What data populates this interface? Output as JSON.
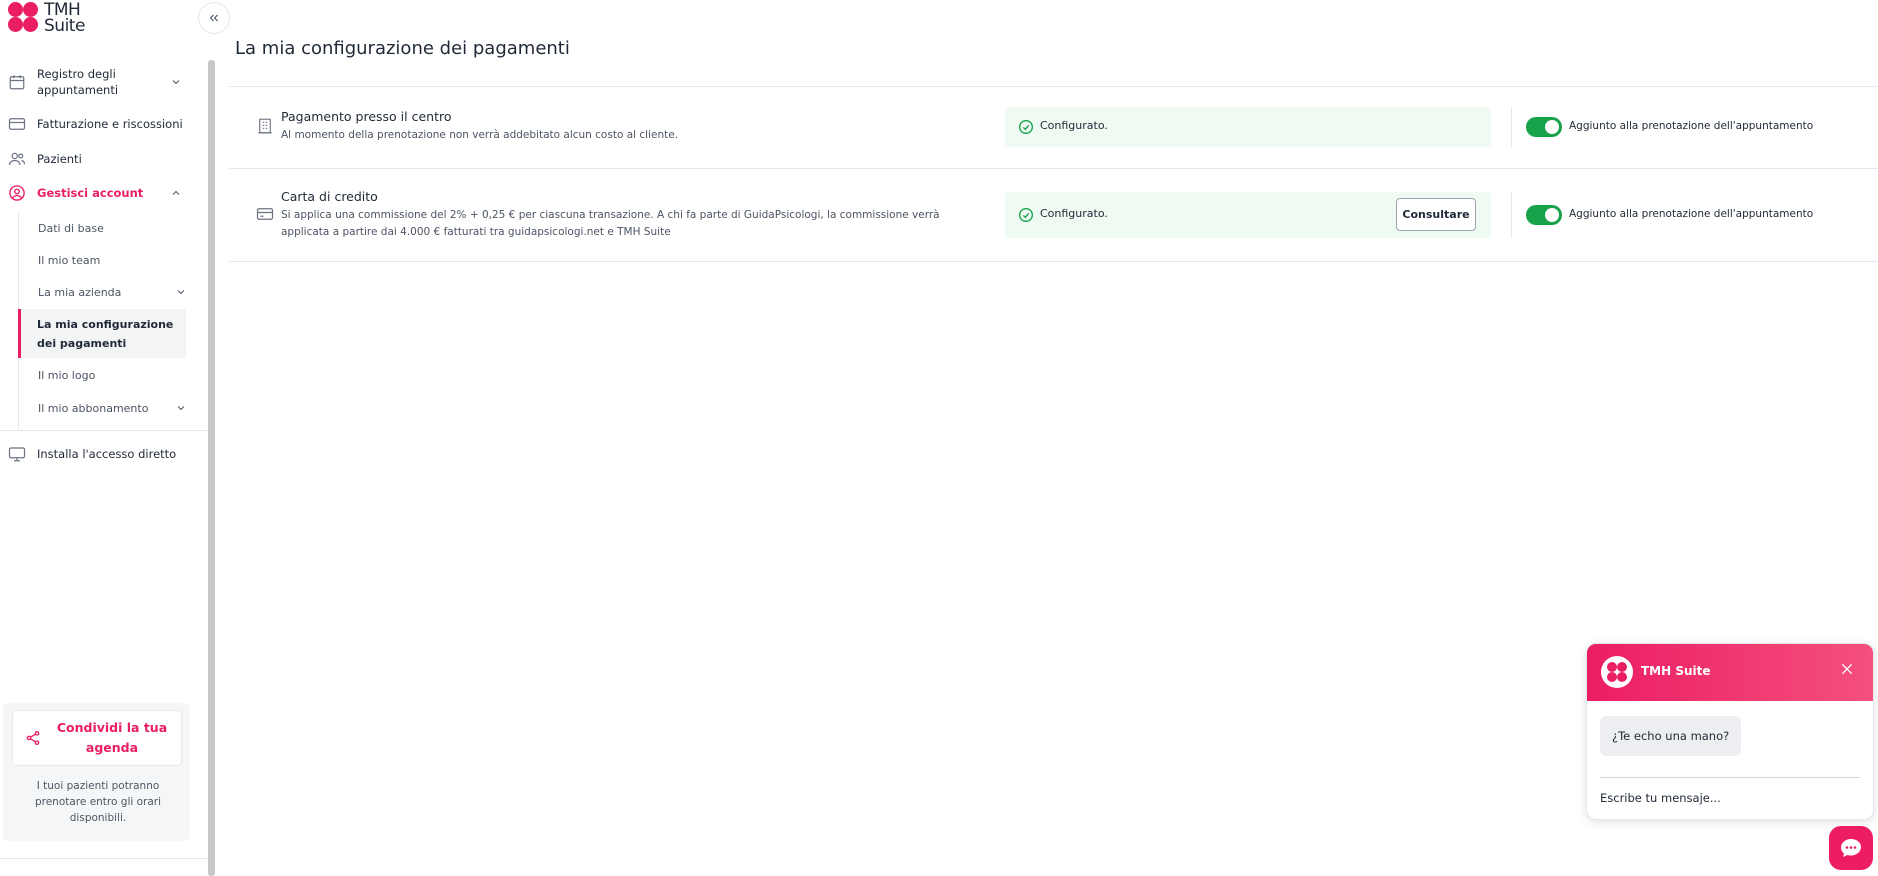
{
  "app": {
    "logo_text": "TMH\nSuite"
  },
  "sidebar": {
    "items": [
      {
        "label": "Registro degli appuntamenti",
        "icon": "calendar-icon"
      },
      {
        "label": "Fatturazione e riscossioni",
        "icon": "credit-card-icon"
      },
      {
        "label": "Pazienti",
        "icon": "users-icon"
      },
      {
        "label": "Gestisci account",
        "icon": "user-circle-icon"
      },
      {
        "label": "Installa l'accesso diretto",
        "icon": "monitor-icon"
      }
    ],
    "sub_items": [
      {
        "label": "Dati di base"
      },
      {
        "label": "Il mio team"
      },
      {
        "label": "La mia azienda"
      },
      {
        "label": "La mia configurazione dei pagamenti"
      },
      {
        "label": "Il mio logo"
      },
      {
        "label": "Il mio abbonamento"
      }
    ],
    "share": {
      "button_label": "Condividi la tua agenda",
      "description": "I tuoi pazienti potranno prenotare entro gli orari disponibili."
    }
  },
  "main": {
    "title": "La mia configurazione dei pagamenti",
    "methods": [
      {
        "title": "Pagamento presso il centro",
        "description": "Al momento della prenotazione non verrà addebitato alcun costo al cliente.",
        "status": "Configurato.",
        "toggle_label": "Aggiunto alla prenotazione dell'appuntamento",
        "enabled": true
      },
      {
        "title": "Carta di credito",
        "description": "Si applica una commissione del 2% + 0,25 € per ciascuna transazione. A chi fa parte di GuidaPsicologi, la commissione verrà applicata a partire dai 4.000 € fatturati tra guidapsicologi.net e TMH Suite",
        "status": "Configurato.",
        "action_label": "Consultare",
        "toggle_label": "Aggiunto alla prenotazione dell'appuntamento",
        "enabled": true
      }
    ]
  },
  "chat": {
    "title": "TMH Suite",
    "bubble": "¿Te echo una mano?",
    "input_placeholder": "Escribe tu mensaje..."
  },
  "colors": {
    "brand": "#e91e63",
    "success": "#16a34a",
    "status_bg": "#effaf3"
  }
}
